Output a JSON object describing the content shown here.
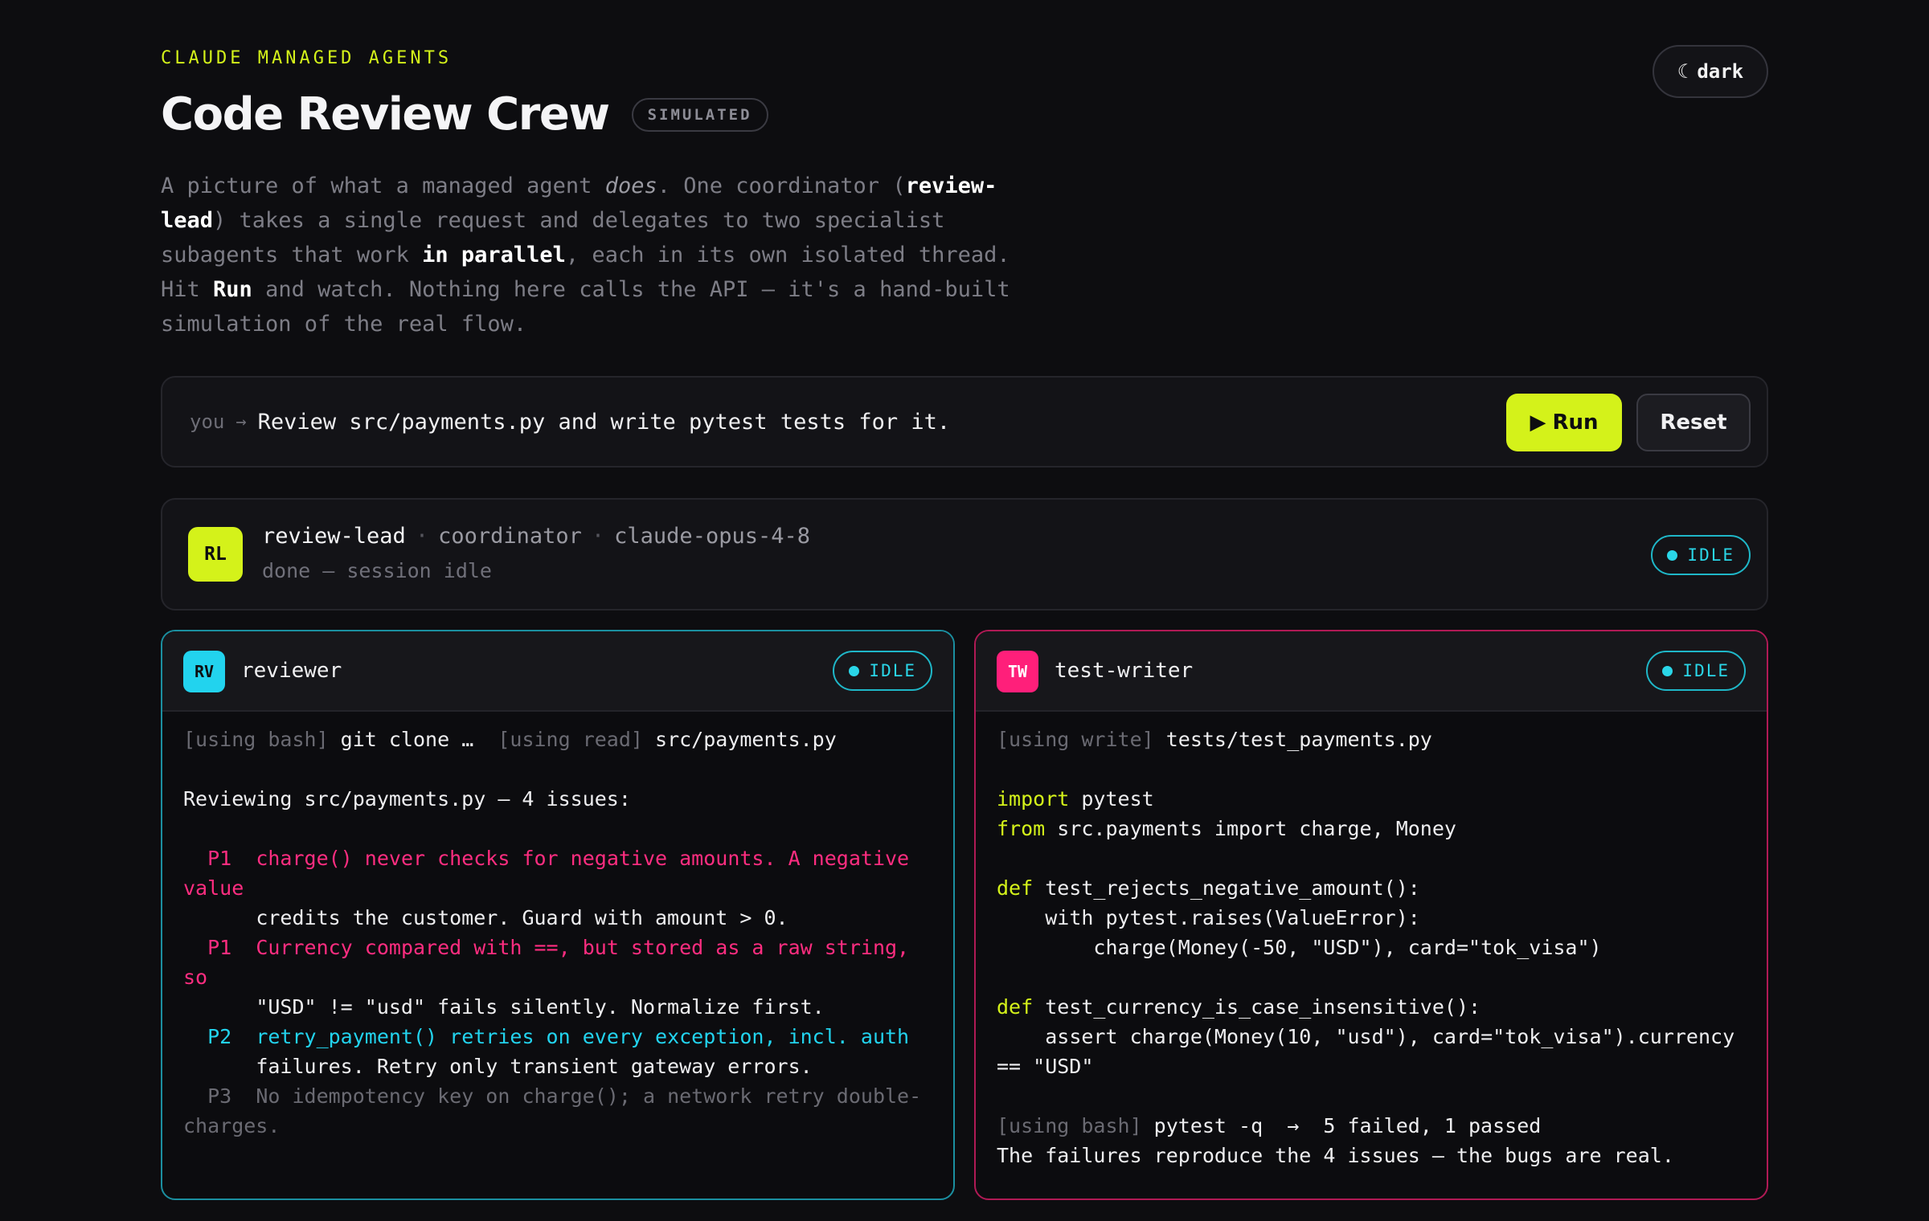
{
  "header": {
    "eyebrow": "CLAUDE MANAGED AGENTS",
    "title": "Code Review Crew",
    "badge": "SIMULATED",
    "theme_icon": "☾",
    "theme_label": "dark"
  },
  "intro": {
    "p1": "A picture of what a managed agent ",
    "does": "does",
    "p2": ". One coordinator (",
    "coordinator": "review-lead",
    "p3": ") takes a single request and delegates to two specialist subagents that work ",
    "parallel": "in parallel",
    "p4": ", each in its own isolated thread. Hit ",
    "run": "Run",
    "p5": " and watch. Nothing here calls the API — it's a hand-built simulation of the real flow."
  },
  "prompt": {
    "speaker": "you",
    "arrow": "→",
    "text": "Review src/payments.py and write pytest tests for it.",
    "run_icon": "▶",
    "run_label": "Run",
    "reset_label": "Reset"
  },
  "coordinator": {
    "initials": "RL",
    "name": "review-lead",
    "sep": "·",
    "role": "coordinator",
    "model": "claude-opus-4-8",
    "status_text": "done — session idle",
    "badge": "IDLE"
  },
  "reviewer": {
    "initials": "RV",
    "name": "reviewer",
    "badge": "IDLE",
    "tool1": "[using bash]",
    "tool1_arg": " git clone …  ",
    "tool2": "[using read]",
    "tool2_arg": " src/payments.py",
    "summary": "Reviewing src/payments.py — 4 issues:",
    "issues": [
      {
        "prio": "  P1  ",
        "head": "charge() never checks for negative amounts. A negative value",
        "rest": "      credits the customer. Guard with amount > 0."
      },
      {
        "prio": "  P1  ",
        "head": "Currency compared with ==, but stored as a raw string, so",
        "rest": "      \"USD\" != \"usd\" fails silently. Normalize first."
      },
      {
        "prio": "  P2  ",
        "head": "retry_payment() retries on every exception, incl. auth",
        "rest": "      failures. Retry only transient gateway errors."
      },
      {
        "prio": "  P3  ",
        "head": "No idempotency key on charge(); a network retry double-charges."
      }
    ]
  },
  "test_writer": {
    "initials": "TW",
    "name": "test-writer",
    "badge": "IDLE",
    "tool1": "[using write]",
    "tool1_arg": " tests/test_payments.py",
    "code": {
      "l1_kw": "import",
      "l1": " pytest",
      "l2_kw": "from",
      "l2": " src.payments import charge, Money",
      "l3_kw": "def",
      "l3": " test_rejects_negative_amount():",
      "l4": "    with pytest.raises(ValueError):",
      "l5": "        charge(Money(-50, \"USD\"), card=\"tok_visa\")",
      "l6_kw": "def",
      "l6": " test_currency_is_case_insensitive():",
      "l7": "    assert charge(Money(10, \"usd\"), card=\"tok_visa\").currency == \"USD\""
    },
    "tool2": "[using bash]",
    "tool2_arg": " pytest -q  →  5 failed, 1 passed",
    "conclusion": "The failures reproduce the 4 issues — the bugs are real."
  }
}
